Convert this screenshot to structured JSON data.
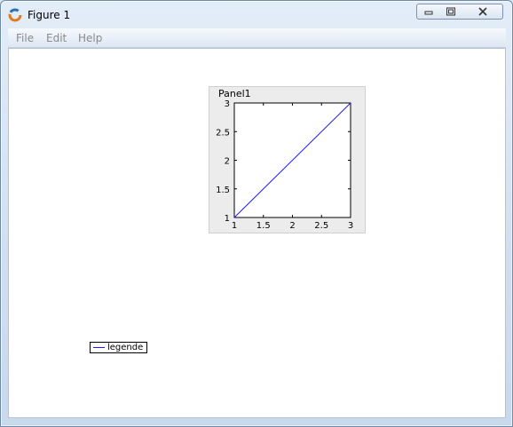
{
  "window": {
    "title": "Figure 1"
  },
  "menu": {
    "items": [
      "File",
      "Edit",
      "Help"
    ]
  },
  "panel": {
    "title": "Panel1"
  },
  "legend": {
    "label": "legende"
  },
  "colors": {
    "line": "#1a1aff",
    "accent_icon": "#e07b20"
  },
  "chart_data": {
    "type": "line",
    "series": [
      {
        "name": "legende",
        "x": [
          1,
          3
        ],
        "y": [
          1,
          3
        ]
      }
    ],
    "xlim": [
      1,
      3
    ],
    "ylim": [
      1,
      3
    ],
    "xticks": [
      "1",
      "1.5",
      "2",
      "2.5",
      "3"
    ],
    "yticks": [
      "1",
      "1.5",
      "2",
      "2.5",
      "3"
    ],
    "grid": false,
    "legend_placement": "detached, lower-left of figure"
  }
}
